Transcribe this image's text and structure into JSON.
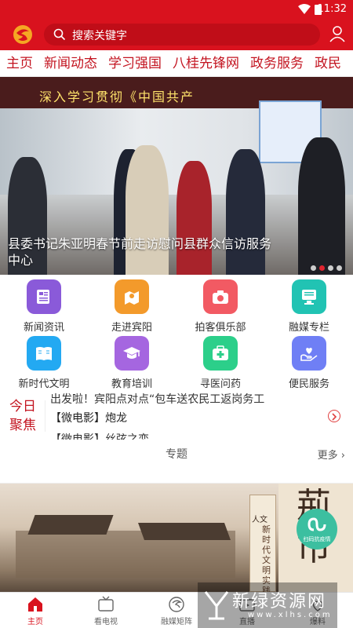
{
  "status_bar": {
    "time": "11:32"
  },
  "header": {
    "search_placeholder": "搜索关键字"
  },
  "nav_tabs": [
    {
      "label": "主页"
    },
    {
      "label": "新闻动态"
    },
    {
      "label": "学习强国"
    },
    {
      "label": "八桂先锋网"
    },
    {
      "label": "政务服务"
    },
    {
      "label": "政民"
    }
  ],
  "banner": {
    "caption": "县委书记朱亚明春节前走访慰问县群众信访服务中心",
    "wall_slogan": "深入学习贯彻《中国共产",
    "dots_count": 4,
    "active_dot": 1
  },
  "grid": [
    {
      "label": "新闻资讯",
      "icon": "newspaper-icon",
      "color": "#8a5ad9"
    },
    {
      "label": "走进宾阳",
      "icon": "map-pin-icon",
      "color": "#f39a2b"
    },
    {
      "label": "拍客俱乐部",
      "icon": "camera-icon",
      "color": "#f25a63"
    },
    {
      "label": "融媒专栏",
      "icon": "monitor-icon",
      "color": "#21c3b3"
    },
    {
      "label": "新时代文明",
      "icon": "book-icon",
      "color": "#23a9f2"
    },
    {
      "label": "教育培训",
      "icon": "graduation-cap-icon",
      "color": "#a566e0"
    },
    {
      "label": "寻医问药",
      "icon": "medical-kit-icon",
      "color": "#2ccf8a"
    },
    {
      "label": "便民服务",
      "icon": "heart-hand-icon",
      "color": "#6f7ff5"
    }
  ],
  "focus": {
    "title": "今日聚焦",
    "items": [
      {
        "text": "出发啦！宾阳点对点“包车送农民工返岗务工"
      },
      {
        "text": "【微电影】炮龙"
      },
      {
        "text": "【微电影】丝弦之恋"
      }
    ]
  },
  "topic": {
    "title": "专题",
    "more": "更多",
    "qr_label": "扫码抗疫情",
    "art_text": "新时代文明实践",
    "art_big": "荊",
    "art_big2": "市",
    "art_side": "人文"
  },
  "watermark": {
    "line1": "新绿资源网",
    "line2": "www.xlhs.com"
  },
  "bottom_nav": [
    {
      "label": "主页",
      "icon": "home-icon"
    },
    {
      "label": "看电视",
      "icon": "tv-icon"
    },
    {
      "label": "融媒矩阵",
      "icon": "matrix-icon"
    },
    {
      "label": "直播",
      "icon": "live-icon"
    },
    {
      "label": "爆料",
      "icon": "report-icon"
    }
  ],
  "colors": {
    "brand": "#d9121e",
    "accent_text": "#c31420"
  }
}
